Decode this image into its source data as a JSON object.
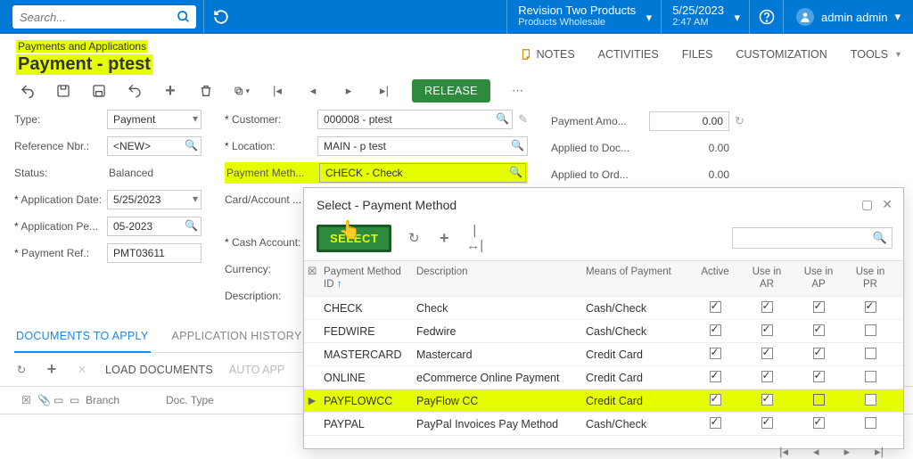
{
  "topbar": {
    "search_placeholder": "Search...",
    "tenant_l1": "Revision Two Products",
    "tenant_l2": "Products Wholesale",
    "date_l1": "5/25/2023",
    "date_l2": "2:47 AM",
    "user": "admin admin"
  },
  "title": {
    "breadcrumb": "Payments and Applications",
    "page_title": "Payment - ptest",
    "actions": {
      "notes": "NOTES",
      "activities": "ACTIVITIES",
      "files": "FILES",
      "customization": "CUSTOMIZATION",
      "tools": "TOOLS"
    }
  },
  "toolbar": {
    "release": "RELEASE"
  },
  "form": {
    "type_label": "Type:",
    "type_value": "Payment",
    "ref_label": "Reference Nbr.:",
    "ref_value": "<NEW>",
    "status_label": "Status:",
    "status_value": "Balanced",
    "appdate_label": "Application Date:",
    "appdate_value": "5/25/2023",
    "appper_label": "Application Pe...",
    "appper_value": "05-2023",
    "payref_label": "Payment Ref.:",
    "payref_value": "PMT03611",
    "customer_label": "Customer:",
    "customer_value": "000008 - ptest",
    "location_label": "Location:",
    "location_value": "MAIN - p test",
    "paymethod_label": "Payment Meth...",
    "paymethod_value": "CHECK - Check",
    "cardacct_label": "Card/Account ...",
    "cashacct_label": "Cash Account:",
    "currency_label": "Currency:",
    "description_label": "Description:",
    "payamt_label": "Payment Amo...",
    "payamt_value": "0.00",
    "applieddoc_label": "Applied to Doc...",
    "applieddoc_value": "0.00",
    "appliedord_label": "Applied to Ord...",
    "appliedord_value": "0.00"
  },
  "tabs": {
    "docs": "DOCUMENTS TO APPLY",
    "history": "APPLICATION HISTORY"
  },
  "gridtools": {
    "load": "LOAD DOCUMENTS",
    "auto": "AUTO APP"
  },
  "gridhead": {
    "branch": "Branch",
    "doctype": "Doc. Type"
  },
  "popup": {
    "title": "Select - Payment Method",
    "select": "SELECT",
    "cols": {
      "id": "Payment Method ID",
      "desc": "Description",
      "means": "Means of Payment",
      "active": "Active",
      "ar": "Use in AR",
      "ap": "Use in AP",
      "pr": "Use in PR"
    },
    "rows": [
      {
        "id": "CHECK",
        "desc": "Check",
        "means": "Cash/Check",
        "active": true,
        "ar": true,
        "ap": true,
        "pr": true
      },
      {
        "id": "FEDWIRE",
        "desc": "Fedwire",
        "means": "Cash/Check",
        "active": true,
        "ar": true,
        "ap": true,
        "pr": false
      },
      {
        "id": "MASTERCARD",
        "desc": "Mastercard",
        "means": "Credit Card",
        "active": true,
        "ar": true,
        "ap": true,
        "pr": false
      },
      {
        "id": "ONLINE",
        "desc": "eCommerce Online Payment",
        "means": "Credit Card",
        "active": true,
        "ar": true,
        "ap": true,
        "pr": false
      },
      {
        "id": "PAYFLOWCC",
        "desc": "PayFlow CC",
        "means": "Credit Card",
        "active": true,
        "ar": true,
        "ap": false,
        "pr": false,
        "selected": true
      },
      {
        "id": "PAYPAL",
        "desc": "PayPal Invoices Pay Method",
        "means": "Cash/Check",
        "active": true,
        "ar": true,
        "ap": true,
        "pr": false
      }
    ]
  }
}
